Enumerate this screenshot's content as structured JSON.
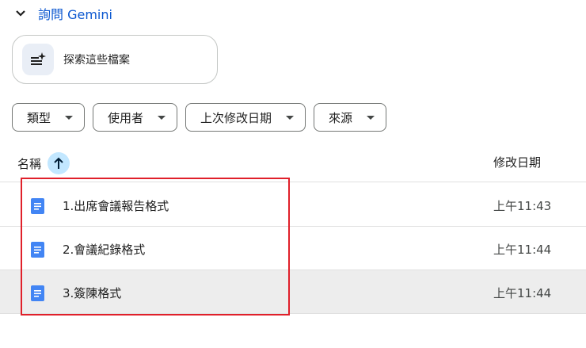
{
  "gemini": {
    "label": "詢問 Gemini",
    "icon": "chevron-down-icon"
  },
  "explore": {
    "label": "探索這些檔案",
    "icon": "sparkle-list-icon"
  },
  "filters": [
    {
      "label": "類型"
    },
    {
      "label": "使用者"
    },
    {
      "label": "上次修改日期"
    },
    {
      "label": "來源"
    }
  ],
  "table": {
    "name_header": "名稱",
    "modified_header": "修改日期",
    "sort_icon": "arrow-up-icon",
    "rows": [
      {
        "name": "1.出席會議報告格式",
        "modified": "上午11:43",
        "icon": "google-docs-icon"
      },
      {
        "name": "2.會議紀錄格式",
        "modified": "上午11:44",
        "icon": "google-docs-icon"
      },
      {
        "name": "3.簽陳格式",
        "modified": "上午11:44",
        "icon": "google-docs-icon",
        "selected": true
      }
    ]
  },
  "colors": {
    "accent": "#0b57d0",
    "highlight_box": "#e0202a",
    "docs_blue": "#4285f4",
    "sort_bg": "#c2e7ff"
  }
}
